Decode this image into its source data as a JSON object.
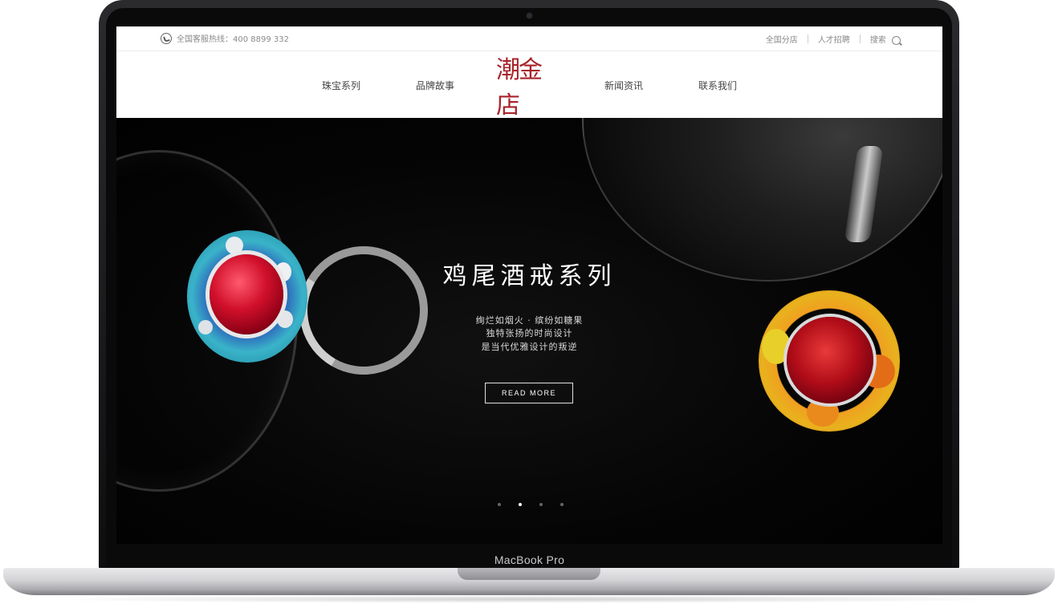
{
  "device": {
    "label": "MacBook Pro"
  },
  "topbar": {
    "hotline": "全国客服热线：400 8899 332",
    "links": [
      "全国分店",
      "人才招聘",
      "搜索"
    ]
  },
  "nav": {
    "left": [
      "珠宝系列",
      "品牌故事"
    ],
    "logo": "潮金店",
    "right": [
      "新闻资讯",
      "联系我们"
    ]
  },
  "hero": {
    "title": "鸡尾酒戒系列",
    "lines": [
      "绚烂如烟火 · 缤纷如糖果",
      "独特张扬的时尚设计",
      "是当代优雅设计的叛逆"
    ],
    "cta": "READ MORE",
    "slides": {
      "count": 4,
      "active_index": 1
    }
  },
  "colors": {
    "brand": "#a8232b",
    "hero_bg": "#000000"
  }
}
